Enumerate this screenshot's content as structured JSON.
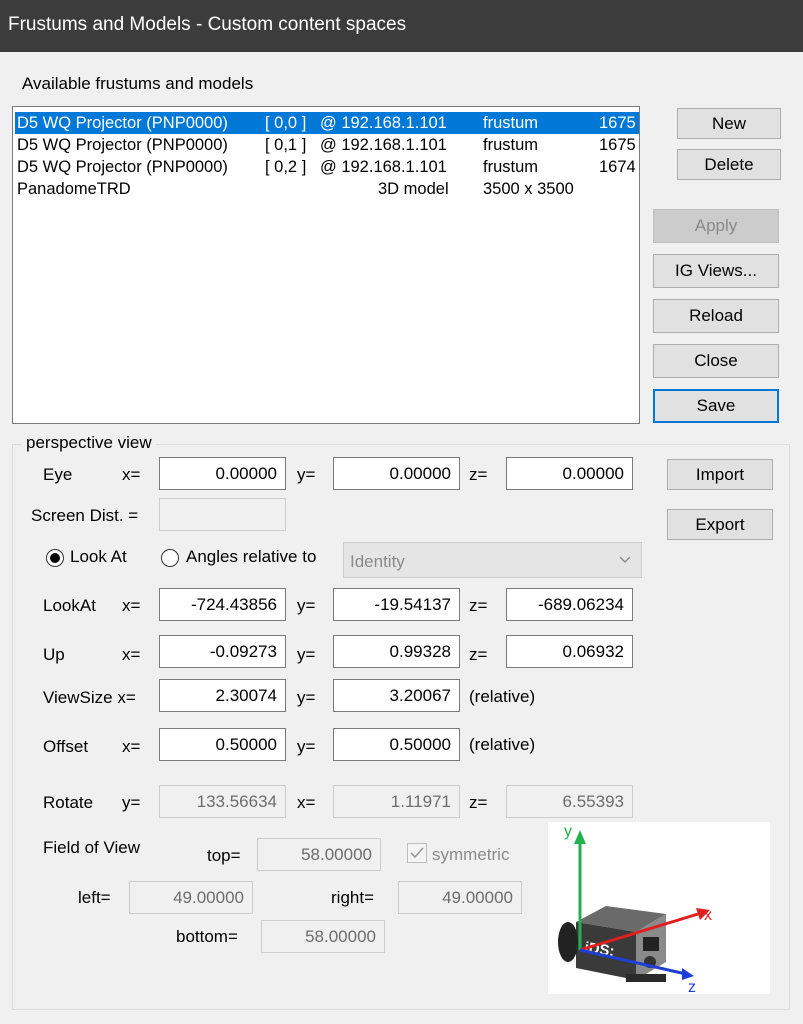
{
  "window": {
    "title": "Frustums and Models - Custom content spaces"
  },
  "list": {
    "label": "Available frustums and models",
    "rows": [
      {
        "name": "D5 WQ Projector (PNP0000)",
        "index": "[ 0,0 ]",
        "address": "@ 192.168.1.101",
        "type": "frustum",
        "size": "1675"
      },
      {
        "name": "D5 WQ Projector (PNP0000)",
        "index": "[ 0,1 ]",
        "address": "@ 192.168.1.101",
        "type": "frustum",
        "size": "1675"
      },
      {
        "name": "D5 WQ Projector (PNP0000)",
        "index": "[ 0,2 ]",
        "address": "@ 192.168.1.101",
        "type": "frustum",
        "size": "1674"
      },
      {
        "name": "PanadomeTRD",
        "index": "",
        "address": "3D model",
        "type": "3500 x 3500",
        "size": ""
      }
    ]
  },
  "buttons": {
    "new": "New",
    "delete": "Delete",
    "apply": "Apply",
    "ig_views": "IG Views...",
    "reload": "Reload",
    "close": "Close",
    "save": "Save",
    "import": "Import",
    "export": "Export"
  },
  "perspective": {
    "group_label": "perspective view",
    "eye": {
      "label": "Eye",
      "x_label": "x=",
      "y_label": "y=",
      "z_label": "z=",
      "x": "0.00000",
      "y": "0.00000",
      "z": "0.00000"
    },
    "screen_dist": {
      "label": "Screen Dist. =",
      "value": ""
    },
    "mode": {
      "look_at_label": "Look At",
      "angles_label": "Angles relative to",
      "selected": "Look At",
      "combo_value": "Identity"
    },
    "lookat": {
      "label": "LookAt",
      "x_label": "x=",
      "y_label": "y=",
      "z_label": "z=",
      "x": "-724.43856",
      "y": "-19.54137",
      "z": "-689.06234"
    },
    "up": {
      "label": "Up",
      "x_label": "x=",
      "y_label": "y=",
      "z_label": "z=",
      "x": "-0.09273",
      "y": "0.99328",
      "z": "0.06932"
    },
    "viewsize": {
      "label": "ViewSize x=",
      "y_label": "y=",
      "x": "2.30074",
      "y": "3.20067",
      "suffix": "(relative)"
    },
    "offset": {
      "label": "Offset",
      "x_label": "x=",
      "y_label": "y=",
      "x": "0.50000",
      "y": "0.50000",
      "suffix": "(relative)"
    },
    "rotate": {
      "label": "Rotate",
      "y_label": "y=",
      "x_label": "x=",
      "z_label": "z=",
      "y": "133.56634",
      "x": "1.11971",
      "z": "6.55393"
    },
    "fov": {
      "label": "Field of View",
      "top_label": "top=",
      "top": "58.00000",
      "left_label": "left=",
      "left": "49.00000",
      "right_label": "right=",
      "right": "49.00000",
      "bottom_label": "bottom=",
      "bottom": "58.00000",
      "symmetric_label": "symmetric",
      "symmetric_checked": true
    }
  },
  "axes": {
    "x": "x",
    "y": "y",
    "z": "z",
    "brand": "iDS:"
  },
  "colors": {
    "selection": "#0078d7",
    "titlebar": "#3c3c3c",
    "axis_x": "#e02020",
    "axis_y": "#22b14c",
    "axis_z": "#1f3ed6"
  }
}
